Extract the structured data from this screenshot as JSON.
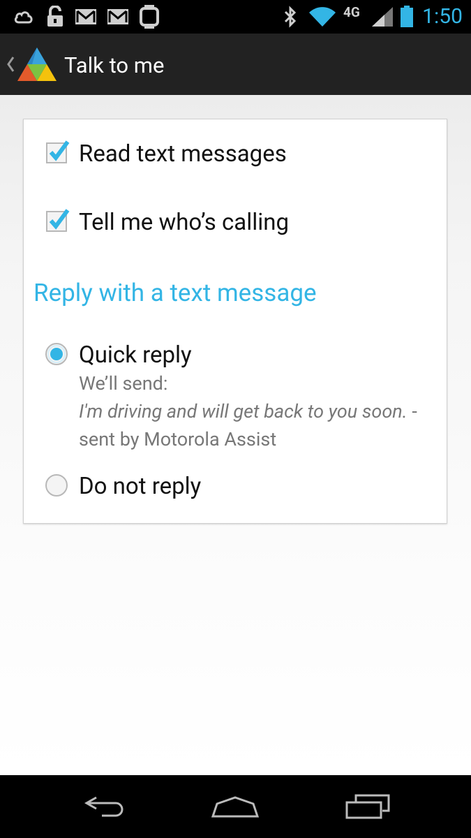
{
  "status_bar": {
    "time": "1:50",
    "network": "4G",
    "icons_left": [
      "cloud-icon",
      "unlock-icon",
      "gmail-icon",
      "gmail-icon",
      "watch-icon"
    ],
    "icons_right": [
      "bluetooth-icon",
      "wifi-icon",
      "signal-icon",
      "battery-icon"
    ],
    "accent_color": "#33b5e5"
  },
  "action_bar": {
    "title": "Talk to me",
    "back_icon": "chevron-left-icon",
    "app_icon": "motorola-assist-icon"
  },
  "settings": {
    "read_texts": {
      "label": "Read text messages",
      "checked": true
    },
    "tell_caller": {
      "label": "Tell me who’s calling",
      "checked": true
    },
    "reply_section_title": "Reply with a text message",
    "quick_reply": {
      "label": "Quick reply",
      "selected": true,
      "send_prefix": "We’ll send:",
      "message": "I'm driving and will get back to you soon.",
      "suffix": "-sent by Motorola Assist"
    },
    "do_not_reply": {
      "label": "Do not reply",
      "selected": false
    }
  },
  "nav_bar": {
    "back": "back-icon",
    "home": "home-icon",
    "recents": "recents-icon"
  }
}
